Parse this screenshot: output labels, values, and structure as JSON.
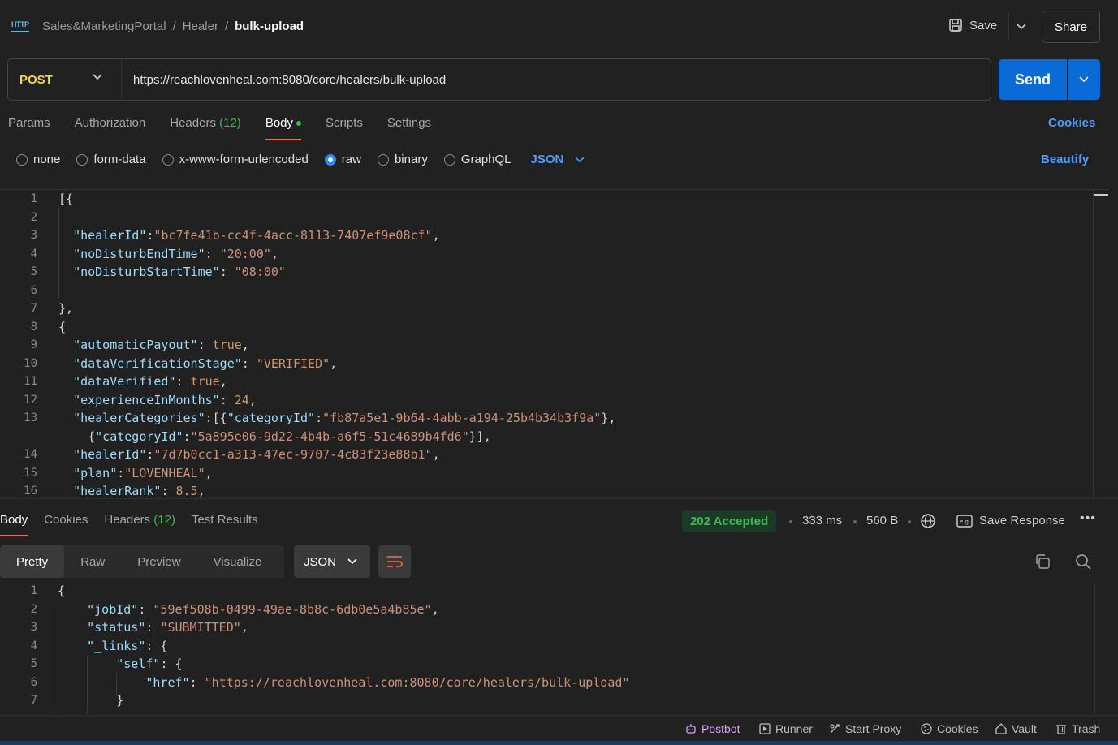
{
  "breadcrumb": {
    "collection": "Sales&MarketingPortal",
    "folder": "Healer",
    "request": "bulk-upload",
    "separator": "/"
  },
  "icons": {
    "app": "http-icon",
    "save": "save-icon",
    "chevron": "chevron-down-icon"
  },
  "header": {
    "save_label": "Save",
    "share_label": "Share"
  },
  "request": {
    "method": "POST",
    "url": "https://reachlovenheal.com:8080/core/healers/bulk-upload",
    "send_label": "Send"
  },
  "req_tabs": {
    "params": "Params",
    "authorization": "Authorization",
    "headers": "Headers",
    "headers_count": "(12)",
    "body": "Body",
    "scripts": "Scripts",
    "settings": "Settings",
    "cookies": "Cookies"
  },
  "body_options": {
    "none": "none",
    "form_data": "form-data",
    "urlencoded": "x-www-form-urlencoded",
    "raw": "raw",
    "binary": "binary",
    "graphql": "GraphQL",
    "format": "JSON",
    "beautify": "Beautify",
    "selected": "raw"
  },
  "request_body_lines": [
    {
      "n": "1",
      "t": "[{"
    },
    {
      "n": "2",
      "t": ""
    },
    {
      "n": "3",
      "t": "  \"healerId\":\"bc7fe41b-cc4f-4acc-8113-7407ef9e08cf\","
    },
    {
      "n": "4",
      "t": "  \"noDisturbEndTime\": \"20:00\","
    },
    {
      "n": "5",
      "t": "  \"noDisturbStartTime\": \"08:00\""
    },
    {
      "n": "6",
      "t": ""
    },
    {
      "n": "7",
      "t": "},"
    },
    {
      "n": "8",
      "t": "{"
    },
    {
      "n": "9",
      "t": "  \"automaticPayout\": true,"
    },
    {
      "n": "10",
      "t": "  \"dataVerificationStage\": \"VERIFIED\","
    },
    {
      "n": "11",
      "t": "  \"dataVerified\": true,"
    },
    {
      "n": "12",
      "t": "  \"experienceInMonths\": 24,"
    },
    {
      "n": "13",
      "t": "  \"healerCategories\":[{\"categoryId\":\"fb87a5e1-9b64-4abb-a194-25b4b34b3f9a\"},"
    },
    {
      "n": "",
      "t": "    {\"categoryId\":\"5a895e06-9d22-4b4b-a6f5-51c4689b4fd6\"}],"
    },
    {
      "n": "14",
      "t": "  \"healerId\":\"7d7b0cc1-a313-47ec-9707-4c83f23e88b1\","
    },
    {
      "n": "15",
      "t": "  \"plan\":\"LOVENHEAL\","
    },
    {
      "n": "16",
      "t": "  \"healerRank\": 8.5,"
    }
  ],
  "response": {
    "tabs": {
      "body": "Body",
      "cookies": "Cookies",
      "headers": "Headers",
      "headers_count": "(12)",
      "test_results": "Test Results"
    },
    "status": "202 Accepted",
    "time": "333 ms",
    "size": "560 B",
    "save_response": "Save Response",
    "view_tabs": {
      "pretty": "Pretty",
      "raw": "Raw",
      "preview": "Preview",
      "visualize": "Visualize"
    },
    "format": "JSON",
    "body_lines": [
      {
        "n": "1",
        "t": "{"
      },
      {
        "n": "2",
        "t": "    \"jobId\": \"59ef508b-0499-49ae-8b8c-6db0e5a4b85e\","
      },
      {
        "n": "3",
        "t": "    \"status\": \"SUBMITTED\","
      },
      {
        "n": "4",
        "t": "    \"_links\": {"
      },
      {
        "n": "5",
        "t": "        \"self\": {"
      },
      {
        "n": "6",
        "t": "            \"href\": \"https://reachlovenheal.com:8080/core/healers/bulk-upload\""
      },
      {
        "n": "7",
        "t": "        }"
      }
    ]
  },
  "statusbar": {
    "postbot": "Postbot",
    "runner": "Runner",
    "start_proxy": "Start Proxy",
    "cookies": "Cookies",
    "vault": "Vault",
    "trash": "Trash"
  },
  "colors": {
    "accent": "#ff6c37",
    "send": "#0a6ad6",
    "method": "#f5d547",
    "status_ok": "#3fb950",
    "link": "#4d9bff"
  }
}
